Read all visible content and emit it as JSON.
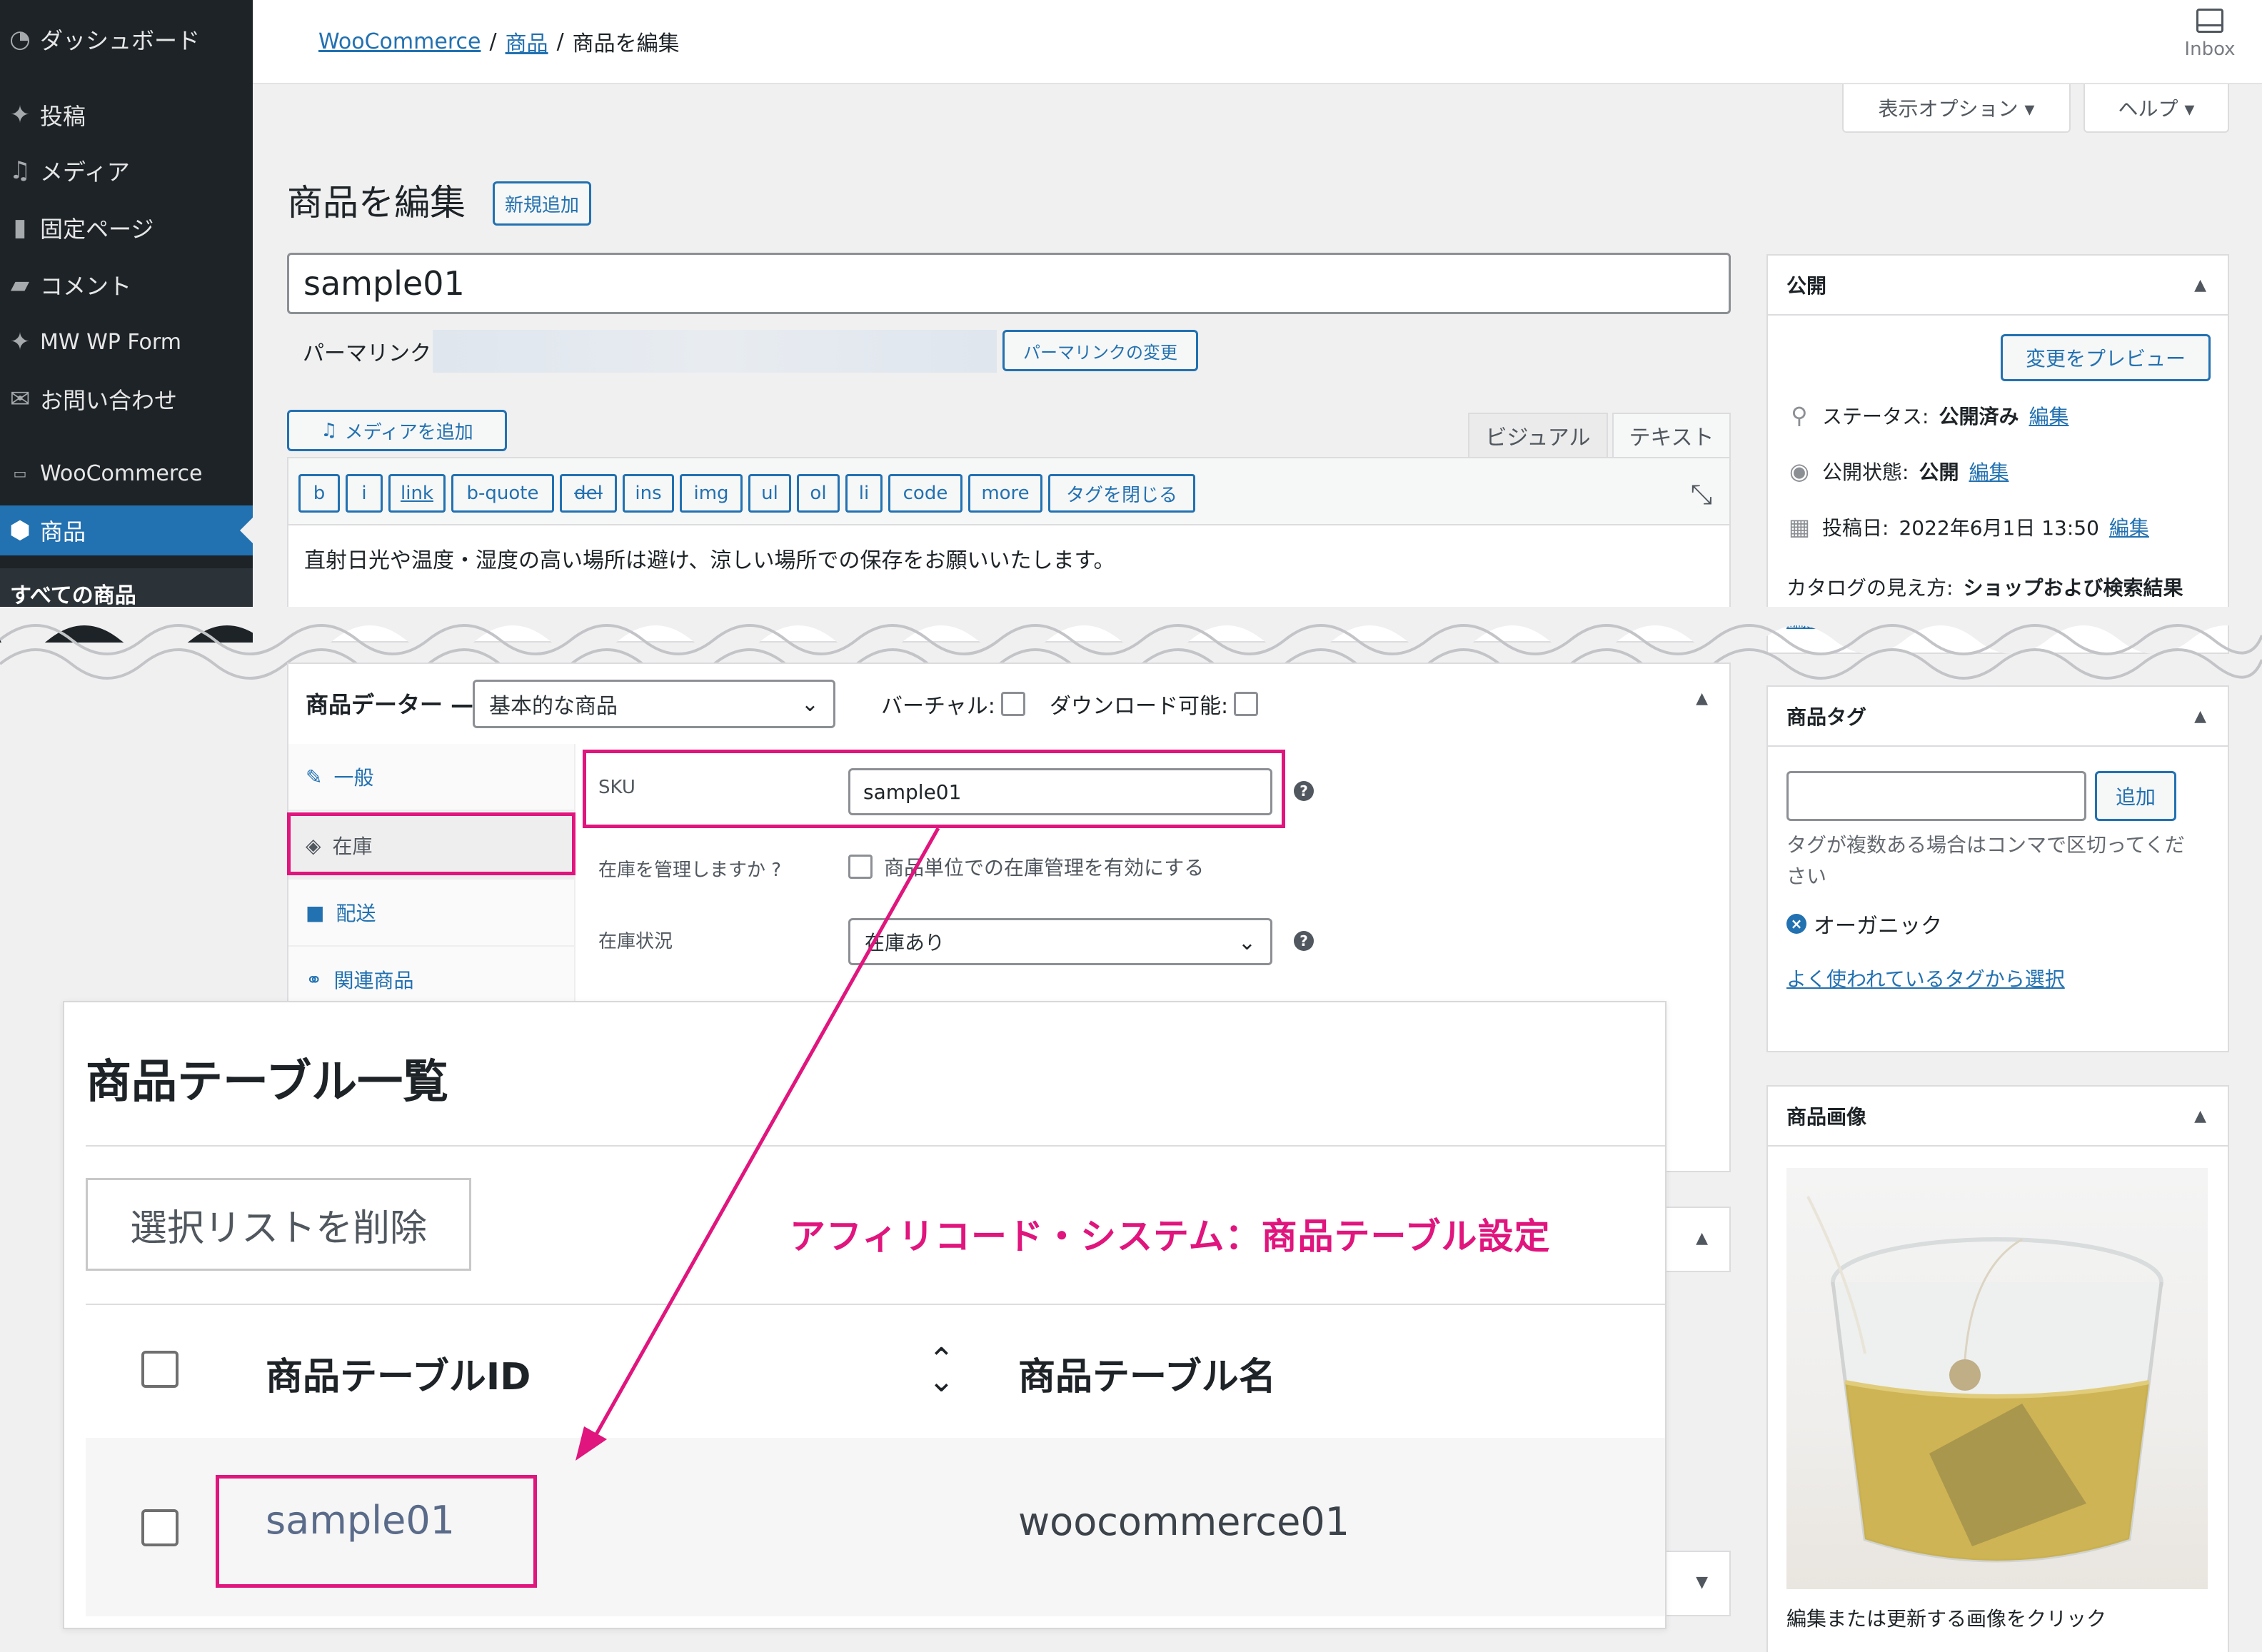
{
  "sidebar": {
    "items": [
      {
        "label": "ダッシュボード",
        "icon": "dashboard-icon"
      },
      {
        "label": "投稿",
        "icon": "pin-icon"
      },
      {
        "label": "メディア",
        "icon": "media-icon"
      },
      {
        "label": "固定ページ",
        "icon": "page-icon"
      },
      {
        "label": "コメント",
        "icon": "comment-icon"
      },
      {
        "label": "MW WP Form",
        "icon": "pin-icon"
      },
      {
        "label": "お問い合わせ",
        "icon": "mail-icon"
      },
      {
        "label": "WooCommerce",
        "icon": "woo-icon"
      },
      {
        "label": "商品",
        "icon": "product-icon"
      }
    ],
    "submenu_active": "すべての商品"
  },
  "breadcrumb": {
    "woo": "WooCommerce",
    "sep1": "/",
    "products": "商品",
    "sep2": "/",
    "current": "商品を編集"
  },
  "topbar": {
    "inbox_label": "Inbox",
    "screen_options": "表示オプション ▾",
    "help": "ヘルプ ▾"
  },
  "page": {
    "title": "商品を編集",
    "add_new": "新規追加"
  },
  "product": {
    "title": "sample01",
    "permalink_label": "パーマリンク:",
    "permalink_change": "パーマリンクの変更"
  },
  "editor": {
    "add_media": "メディアを追加",
    "tab_visual": "ビジュアル",
    "tab_text": "テキスト",
    "quicktags": [
      "b",
      "i",
      "link",
      "b-quote",
      "del",
      "ins",
      "img",
      "ul",
      "ol",
      "li",
      "code",
      "more",
      "タグを閉じる"
    ],
    "content": "直射日光や温度・湿度の高い場所は避け、涼しい場所での保存をお願いいたします。"
  },
  "publish": {
    "title": "公開",
    "preview": "変更をプレビュー",
    "status_label": "ステータス:",
    "status_value": "公開済み",
    "visibility_label": "公開状態:",
    "visibility_value": "公開",
    "date_label": "投稿日:",
    "date_value": "2022年6月1日 13:50",
    "catalog_label": "カタログの見え方:",
    "catalog_value": "ショップおよび検索結果",
    "edit": "編集"
  },
  "product_data": {
    "label": "商品データー —",
    "type_selected": "基本的な商品",
    "virtual_label": "バーチャル:",
    "downloadable_label": "ダウンロード可能:",
    "tabs": [
      "一般",
      "在庫",
      "配送",
      "関連商品"
    ],
    "sku_label": "SKU",
    "sku_value": "sample01",
    "manage_stock_label": "在庫を管理しますか ?",
    "manage_stock_text": "商品単位での在庫管理を有効にする",
    "stock_status_label": "在庫状況",
    "stock_status_value": "在庫あり"
  },
  "product_tags": {
    "title": "商品タグ",
    "add": "追加",
    "note": "タグが複数ある場合はコンマで区切ってください",
    "tags": [
      "オーガニック"
    ],
    "popular_link": "よく使われているタグから選択"
  },
  "product_image": {
    "title": "商品画像",
    "caption": "編集または更新する画像をクリック"
  },
  "overlay": {
    "title": "商品テーブル一覧",
    "delete_button": "選択リストを削除",
    "caption": "アフィリコード・システム：商品テーブル設定",
    "col_id": "商品テーブルID",
    "col_name": "商品テーブル名",
    "rows": [
      {
        "id": "sample01",
        "name": "woocommerce01"
      }
    ]
  },
  "colors": {
    "accent": "#2271b1",
    "highlight": "#e0157d",
    "sidebar": "#1d2327"
  }
}
